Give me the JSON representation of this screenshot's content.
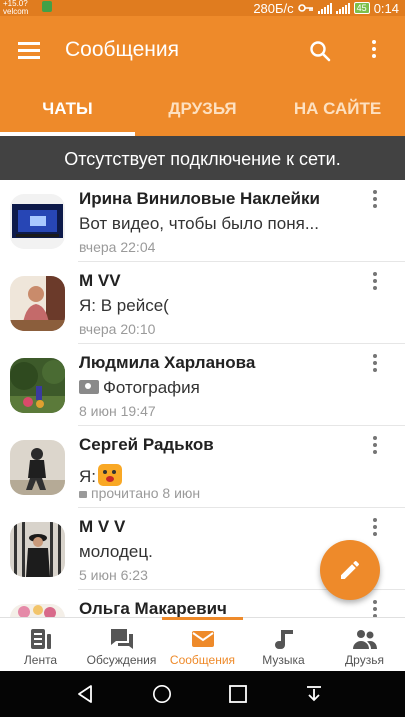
{
  "status_bar": {
    "operator_top": "+15.0?",
    "operator": "velcom",
    "net_speed": "280Б/с",
    "battery": "45",
    "time": "0:14"
  },
  "app_bar": {
    "title": "Сообщения"
  },
  "tabs": [
    {
      "label": "ЧАТЫ",
      "active": true
    },
    {
      "label": "ДРУЗЬЯ",
      "active": false
    },
    {
      "label": "НА САЙТЕ",
      "active": false
    }
  ],
  "banner": "Отсутствует подключение к сети.",
  "chats": [
    {
      "name": "Ирина Виниловые Наклейки",
      "preview": "Вот видео, чтобы было поня...",
      "time": "вчера 22:04"
    },
    {
      "name": "M VV",
      "preview": "Я: В рейсе(",
      "time": "вчера 20:10"
    },
    {
      "name": "Людмила Харланова",
      "preview": "Фотография",
      "time": "8 июн 19:47"
    },
    {
      "name": "Сергей Радьков",
      "preview": "Я:",
      "time": "прочитано 8 июн"
    },
    {
      "name": "M V V",
      "preview": "молодец.",
      "time": "5 июн 6:23"
    },
    {
      "name": "Ольга Макаревич",
      "preview": "",
      "time": ""
    }
  ],
  "bottom_nav": [
    {
      "label": "Лента",
      "icon": "feed-icon",
      "active": false
    },
    {
      "label": "Обсуждения",
      "icon": "discussions-icon",
      "active": false
    },
    {
      "label": "Сообщения",
      "icon": "messages-icon",
      "active": true
    },
    {
      "label": "Музыка",
      "icon": "music-icon",
      "active": false
    },
    {
      "label": "Друзья",
      "icon": "friends-icon",
      "active": false
    }
  ],
  "colors": {
    "accent": "#ee8a2a",
    "banner": "#424242",
    "status_bar": "#e07c1f"
  }
}
